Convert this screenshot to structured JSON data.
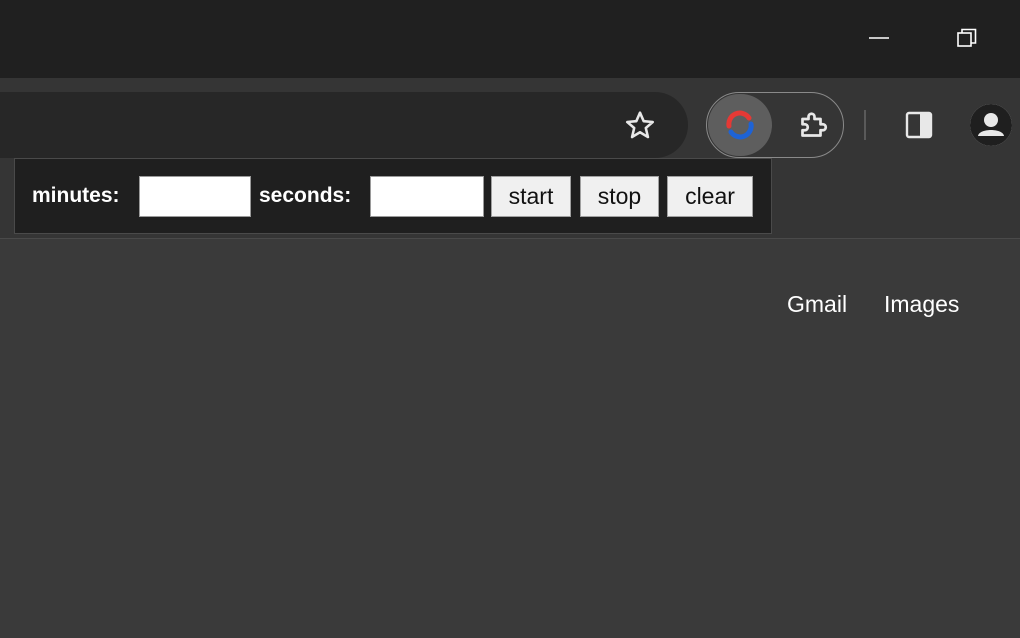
{
  "window_controls": {
    "minimize_icon": "minimize-icon",
    "restore_icon": "restore-icon"
  },
  "toolbar": {
    "bookmark_icon": "star-outline-icon",
    "active_extension_icon": "sync-arrows-icon",
    "extensions_icon": "puzzle-piece-icon",
    "side_panel_icon": "side-panel-icon",
    "profile_icon": "person-avatar-icon"
  },
  "timer_popup": {
    "minutes_label": "minutes:",
    "minutes_value": "",
    "seconds_label": "seconds:",
    "seconds_value": "",
    "start_label": "start",
    "stop_label": "stop",
    "clear_label": "clear"
  },
  "page_links": {
    "gmail": "Gmail",
    "images": "Images"
  },
  "colors": {
    "titlebar_bg": "#202020",
    "toolbar_bg": "#353535",
    "page_bg": "#3a3a3a",
    "popup_bg": "#1f1f1f",
    "extension_red": "#e53935",
    "extension_blue": "#1e63d6"
  }
}
